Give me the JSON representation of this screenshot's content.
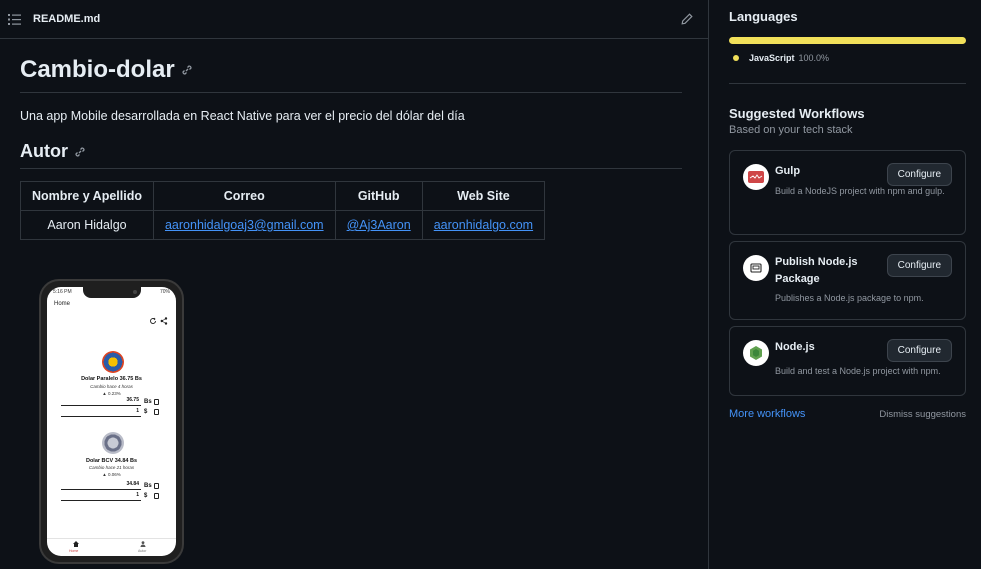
{
  "readme": {
    "filename": "README.md",
    "title": "Cambio-dolar",
    "description": "Una app Mobile desarrollada en React Native para ver el precio del dólar del día",
    "section_title": "Autor",
    "table": {
      "headers": [
        "Nombre y Apellido",
        "Correo",
        "GitHub",
        "Web Site"
      ],
      "row": [
        "Aaron Hidalgo",
        "aaronhidalgoaj3@gmail.com",
        "@Aj3Aaron",
        "aaronhidalgo.com"
      ]
    },
    "phone": {
      "status_time": "5:16 PM",
      "status_batt": "70%",
      "header": "Home",
      "rate1_title": "Dolar Paralelo 36.75 Bs",
      "rate1_sub": "Cambio hace 4 horas",
      "rate1_pct": "▲ 0.23%",
      "rate1_value": "36.75",
      "rate1_unit": "Bs",
      "rate1_one": "1",
      "rate1_dollar": "$",
      "rate2_title": "Dolar BCV 34.84 Bs",
      "rate2_sub": "Cambio hace 21 horas",
      "rate2_pct": "▲ 0.06%",
      "rate2_value": "34.84",
      "rate2_unit": "Bs",
      "rate2_one": "1",
      "rate2_dollar": "$",
      "tab_home": "Home",
      "tab_user": "Autor"
    }
  },
  "sidebar": {
    "languages_title": "Languages",
    "language": {
      "name": "JavaScript",
      "percent": "100.0%",
      "color": "#f1e05a"
    },
    "workflows_title": "Suggested Workflows",
    "workflows_subtitle": "Based on your tech stack",
    "workflows": [
      {
        "name": "Gulp",
        "desc": "Build a NodeJS project with npm and gulp.",
        "button": "Configure",
        "icon": "gulp-icon"
      },
      {
        "name": "Publish Node.js Package",
        "desc": "Publishes a Node.js package to npm.",
        "button": "Configure",
        "icon": "package-icon"
      },
      {
        "name": "Node.js",
        "desc": "Build and test a Node.js project with npm.",
        "button": "Configure",
        "icon": "nodejs-icon"
      }
    ],
    "more_workflows": "More workflows",
    "dismiss": "Dismiss suggestions"
  }
}
